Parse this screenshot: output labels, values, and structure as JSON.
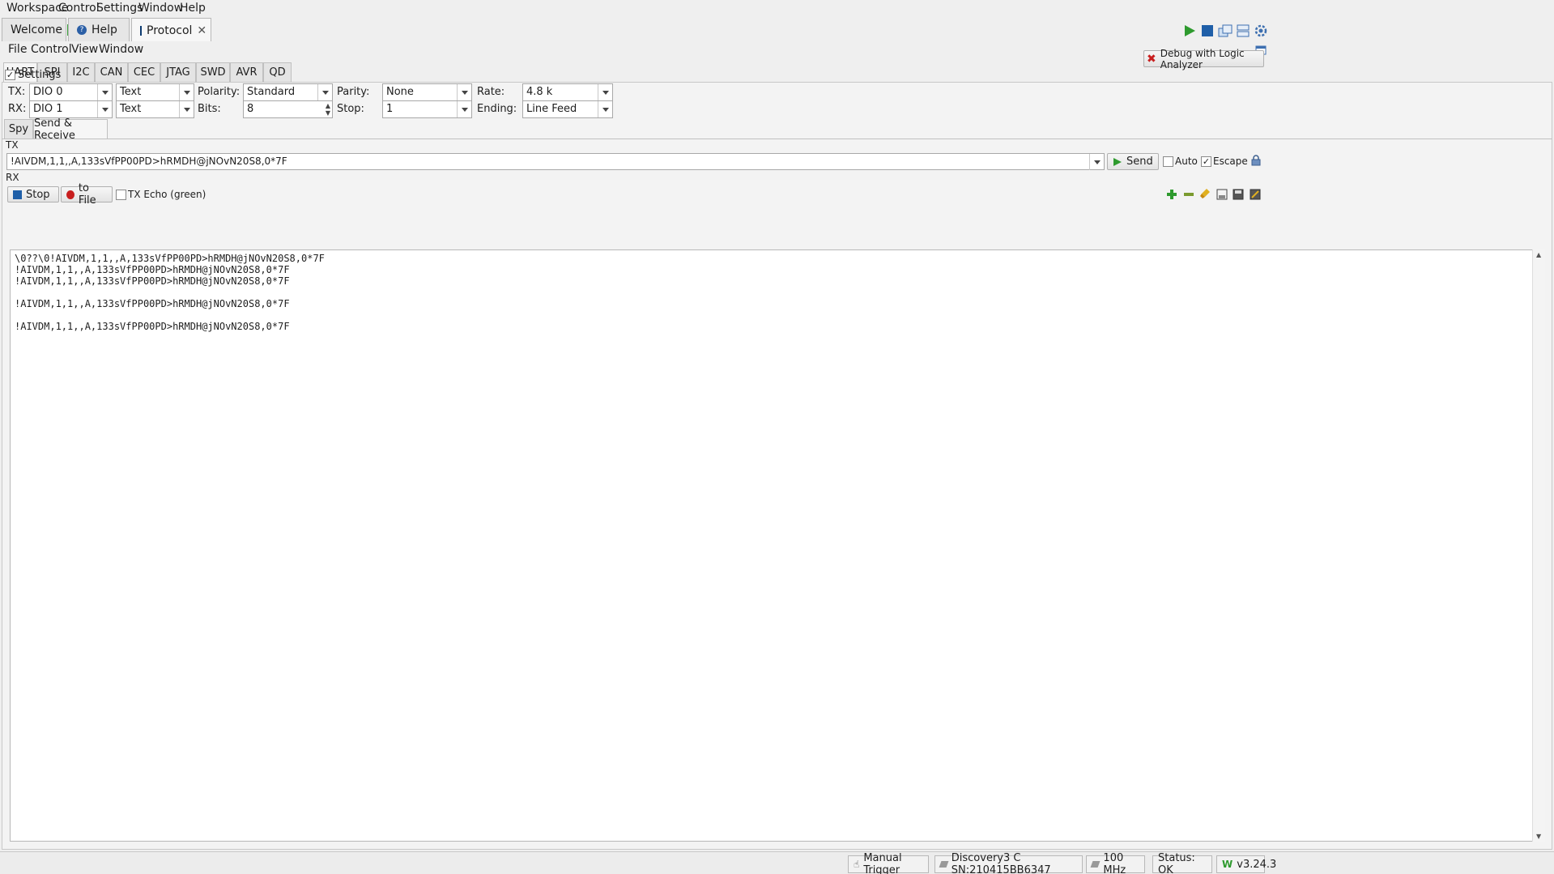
{
  "top_menu": [
    "Workspace",
    "Control",
    "Settings",
    "Window",
    "Help"
  ],
  "workspace_tabs": {
    "welcome": "Welcome",
    "help": "Help",
    "protocol": "Protocol"
  },
  "inner_menu": [
    "File",
    "Control",
    "View",
    "Window"
  ],
  "protocol_tabs": [
    "UART",
    "SPI",
    "I2C",
    "CAN",
    "CEC",
    "JTAG",
    "SWD",
    "AVR",
    "QD"
  ],
  "debug_button": "Debug with Logic Analyzer",
  "settings": {
    "checkbox_label": "Settings",
    "tx_label": "TX:",
    "tx_pin": "DIO 0",
    "tx_format": "Text",
    "rx_label": "RX:",
    "rx_pin": "DIO 1",
    "rx_format": "Text",
    "polarity_label": "Polarity:",
    "polarity": "Standard",
    "bits_label": "Bits:",
    "bits": "8",
    "parity_label": "Parity:",
    "parity": "None",
    "stop_label": "Stop:",
    "stop": "1",
    "rate_label": "Rate:",
    "rate": "4.8 k",
    "ending_label": "Ending:",
    "ending": "Line Feed"
  },
  "sub_tabs": [
    "Spy",
    "Send & Receive"
  ],
  "tx": {
    "section_label": "TX",
    "value": "!AIVDM,1,1,,A,133sVfPP00PD>hRMDH@jNOvN20S8,0*7F",
    "send_label": "Send",
    "auto_label": "Auto",
    "escape_label": "Escape"
  },
  "rx": {
    "section_label": "RX",
    "stop_label": "Stop",
    "to_file_label": "to File",
    "tx_echo_label": "TX Echo (green)",
    "lines": [
      "\\0??\\0!AIVDM,1,1,,A,133sVfPP00PD>hRMDH@jNOvN20S8,0*7F",
      "!AIVDM,1,1,,A,133sVfPP00PD>hRMDH@jNOvN20S8,0*7F",
      "!AIVDM,1,1,,A,133sVfPP00PD>hRMDH@jNOvN20S8,0*7F",
      "",
      "!AIVDM,1,1,,A,133sVfPP00PD>hRMDH@jNOvN20S8,0*7F",
      "",
      "!AIVDM,1,1,,A,133sVfPP00PD>hRMDH@jNOvN20S8,0*7F"
    ]
  },
  "status_bar": {
    "trigger": "Manual Trigger",
    "device": "Discovery3 C SN:210415BB6347",
    "clock": "100 MHz",
    "status": "Status: OK",
    "version": "v3.24.3"
  },
  "colors": {
    "green_icon": "#2e9a2e",
    "blue_icon": "#1f5fa8",
    "red_icon": "#c81e1e"
  }
}
